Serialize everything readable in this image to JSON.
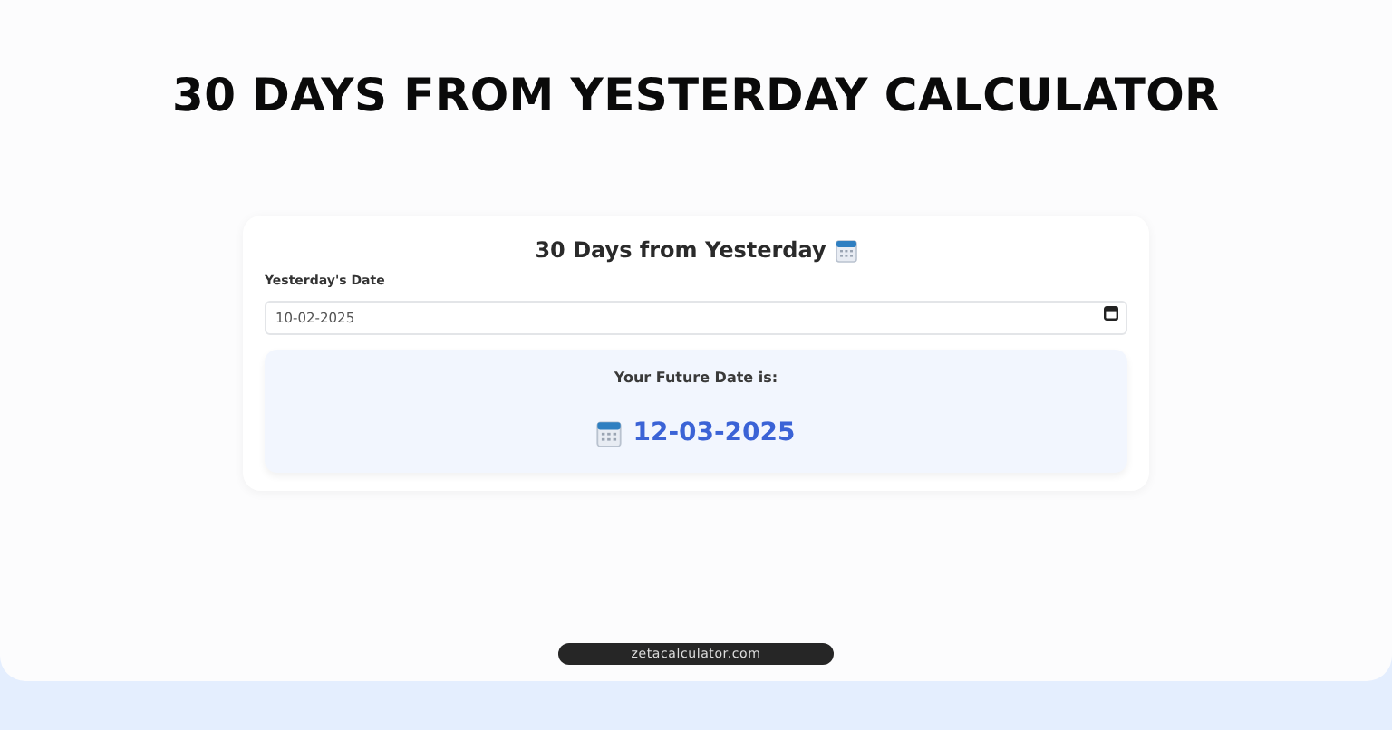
{
  "heading": "30 DAYS FROM YESTERDAY CALCULATOR",
  "card": {
    "title": "30 Days from Yesterday",
    "field": {
      "label": "Yesterday's Date",
      "value": "10-02-2025"
    },
    "result": {
      "label": "Your Future Date is:",
      "date": "12-03-2025"
    }
  },
  "footer": "zetacalculator.com"
}
